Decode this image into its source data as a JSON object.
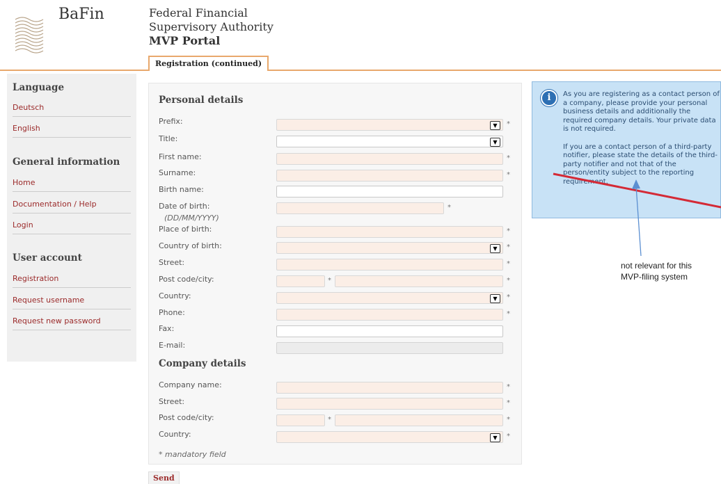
{
  "header": {
    "logo_text": "BaFin",
    "org_line1": "Federal Financial",
    "org_line2": "Supervisory Authority",
    "portal_name": "MVP Portal",
    "active_tab": "Registration (continued)"
  },
  "sidebar": {
    "sections": [
      {
        "title": "Language",
        "items": [
          "Deutsch",
          "English"
        ]
      },
      {
        "title": "General information",
        "items": [
          "Home",
          "Documentation / Help",
          "Login"
        ]
      },
      {
        "title": "User account",
        "items": [
          "Registration",
          "Request username",
          "Request new password"
        ]
      }
    ]
  },
  "form": {
    "personal_heading": "Personal details",
    "personal_fields": {
      "prefix": "Prefix:",
      "title": "Title:",
      "first_name": "First name:",
      "surname": "Surname:",
      "birth_name": "Birth name:",
      "date_of_birth": "Date of birth:",
      "date_hint": "(DD/MM/YYYY)",
      "place_of_birth": "Place of birth:",
      "country_of_birth": "Country of birth:",
      "street": "Street:",
      "post_code_city": "Post code/city:",
      "country": "Country:",
      "phone": "Phone:",
      "fax": "Fax:",
      "email": "E-mail:"
    },
    "company_heading": "Company details",
    "company_fields": {
      "company_name": "Company name:",
      "street": "Street:",
      "post_code_city": "Post code/city:",
      "country": "Country:"
    },
    "required_marker": "*",
    "mandatory_note": "* mandatory field",
    "send_label": "Send"
  },
  "info_box": {
    "icon": "info-icon",
    "paragraph1": "As you are registering as a contact person of a company, please provide your personal business details and additionally the required company details. Your private data is not required.",
    "paragraph2": "If you are a contact person of a third-party notifier, please state the details of the third-party notifier and not that of the person/entity subject to the reporting requirement."
  },
  "annotation": {
    "note_line1": "not relevant for this",
    "note_line2": "MVP-filing system",
    "strike_color": "#d42a36",
    "arrow_color": "#5b8fd1"
  },
  "colors": {
    "accent_link": "#9b2a2a",
    "tab_border": "#e8a86c",
    "required_field_bg": "#fbeee6",
    "info_bg": "#c8e2f6"
  }
}
